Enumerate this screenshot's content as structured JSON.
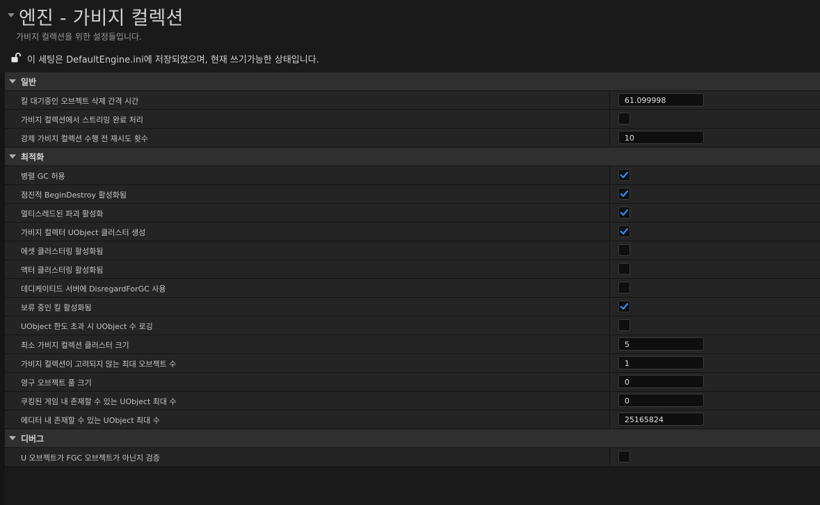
{
  "header": {
    "title": "엔진 - 가비지 컬렉션",
    "subtitle": "가비지 컬렉션을 위한 설정들입니다.",
    "notice": "이 세팅은 DefaultEngine.ini에 저장되었으며, 현재 쓰기가능한 상태입니다."
  },
  "colors": {
    "checkmark": "#2f8fff",
    "category_bg": "#2f2f2f",
    "row_bg": "#242424"
  },
  "sections": [
    {
      "title": "일반",
      "rows": [
        {
          "label": "킬 대기중인 오브젝트 삭제 간격 시간",
          "type": "number",
          "value": "61.099998"
        },
        {
          "label": "가비지 컬렉션에서 스트리밍 완료 처리",
          "type": "checkbox",
          "checked": false
        },
        {
          "label": "강제 가비지 컬렉션 수행 전 재시도 횟수",
          "type": "number",
          "value": "10"
        }
      ]
    },
    {
      "title": "최적화",
      "rows": [
        {
          "label": "병렬 GC 허용",
          "type": "checkbox",
          "checked": true
        },
        {
          "label": "점진적 BeginDestroy 활성화됨",
          "type": "checkbox",
          "checked": true
        },
        {
          "label": "멀티스레드된 파괴 활성화",
          "type": "checkbox",
          "checked": true
        },
        {
          "label": "가비지 컬렉터 UObject 클러스터 생성",
          "type": "checkbox",
          "checked": true
        },
        {
          "label": "에셋 클러스터링 활성화됨",
          "type": "checkbox",
          "checked": false
        },
        {
          "label": "액터 클러스터링 활성화됨",
          "type": "checkbox",
          "checked": false
        },
        {
          "label": "데디케이티드 서버에 DisregardForGC 사용",
          "type": "checkbox",
          "checked": false
        },
        {
          "label": "보류 중인 킬 활성화됨",
          "type": "checkbox",
          "checked": true
        },
        {
          "label": "UObject 한도 초과 시 UObject 수 로깅",
          "type": "checkbox",
          "checked": false
        },
        {
          "label": "최소 가비지 컬렉션 클러스터 크기",
          "type": "number",
          "value": "5"
        },
        {
          "label": "가비지 컬렉션이 고려되지 않는 최대 오브젝트 수",
          "type": "number",
          "value": "1"
        },
        {
          "label": "영구 오브젝트 풀 크기",
          "type": "number",
          "value": "0"
        },
        {
          "label": "쿠킹된 게임 내 존재할 수 있는 UObject 최대 수",
          "type": "number",
          "value": "0"
        },
        {
          "label": "에디터 내 존재할 수 있는 UObject 최대 수",
          "type": "number",
          "value": "25165824"
        }
      ]
    },
    {
      "title": "디버그",
      "rows": [
        {
          "label": "U 오브젝트가 FGC 오브젝트가 아닌지 검증",
          "type": "checkbox",
          "checked": false
        }
      ]
    }
  ]
}
